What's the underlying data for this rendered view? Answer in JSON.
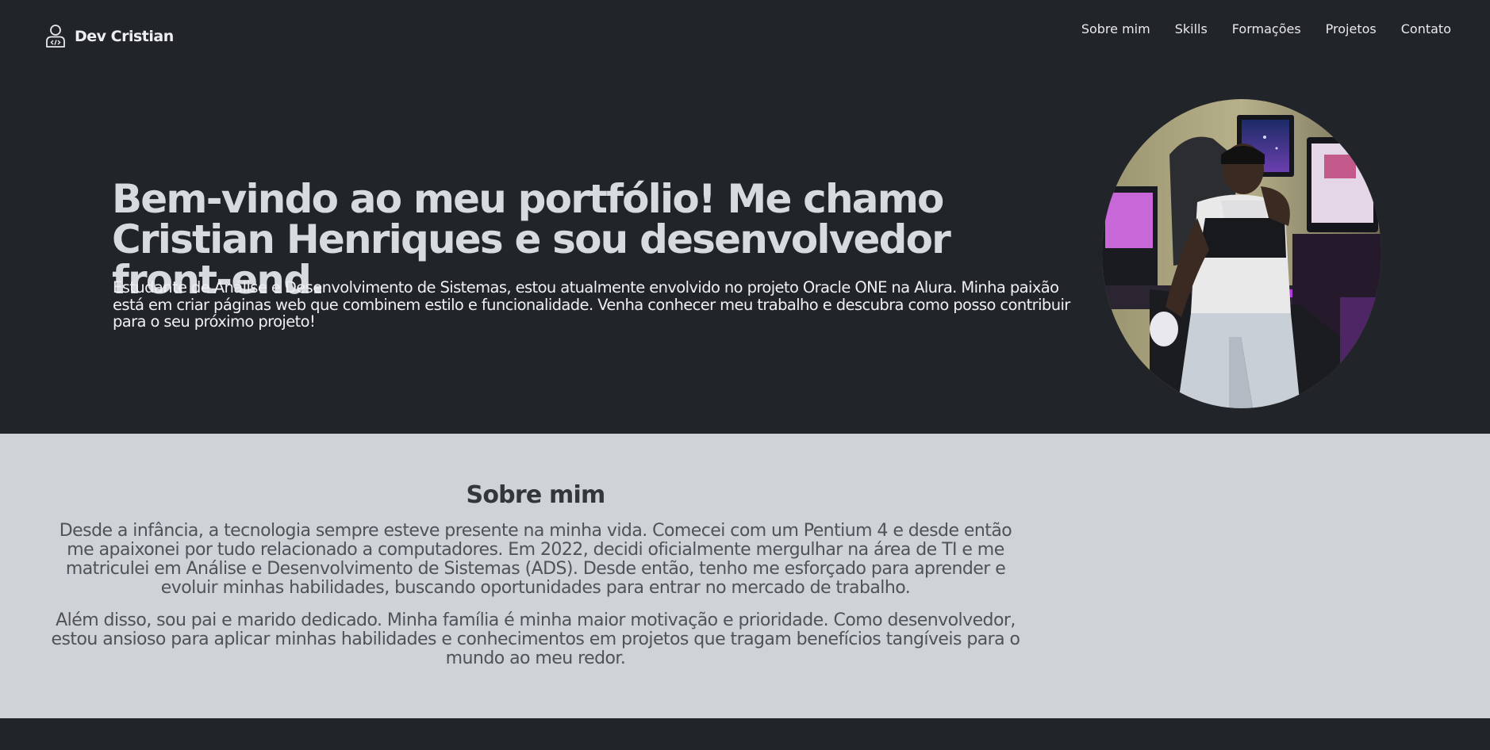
{
  "header": {
    "brand_name": "Dev Cristian",
    "brand_icon": "developer-user-icon",
    "nav": [
      "Sobre mim",
      "Skills",
      "Formações",
      "Projetos",
      "Contato"
    ]
  },
  "hero": {
    "title": "Bem-vindo ao meu portfólio! Me chamo Cristian Henriques e sou desenvolvedor front-end.",
    "text": "Estudante de Análise e Desenvolvimento de Sistemas, estou atualmente envolvido no projeto Oracle ONE na Alura. Minha paixão está em criar páginas web que combinem estilo e funcionalidade. Venha conhecer meu trabalho e descubra como posso contribuir para o seu próximo projeto!",
    "photo_icon": "profile-photo"
  },
  "about": {
    "title": "Sobre mim",
    "paragraph1": "Desde a infância, a tecnologia sempre esteve presente na minha vida. Comecei com um Pentium 4 e desde então me apaixonei por tudo relacionado a computadores. Em 2022, decidi oficialmente mergulhar na área de TI e me matriculei em Análise e Desenvolvimento de Sistemas (ADS). Desde então, tenho me esforçado para aprender e evoluir minhas habilidades, buscando oportunidades para entrar no mercado de trabalho.",
    "paragraph2": "Além disso, sou pai e marido dedicado. Minha família é minha maior motivação e prioridade. Como desenvolvedor, estou ansioso para aplicar minhas habilidades e conhecimentos em projetos que tragam benefícios tangíveis para o mundo ao meu redor."
  },
  "colors": {
    "dark_bg": "#212429",
    "light_section": "#cfd3d8",
    "hero_title": "#d7dade",
    "about_text": "#4f5257"
  }
}
